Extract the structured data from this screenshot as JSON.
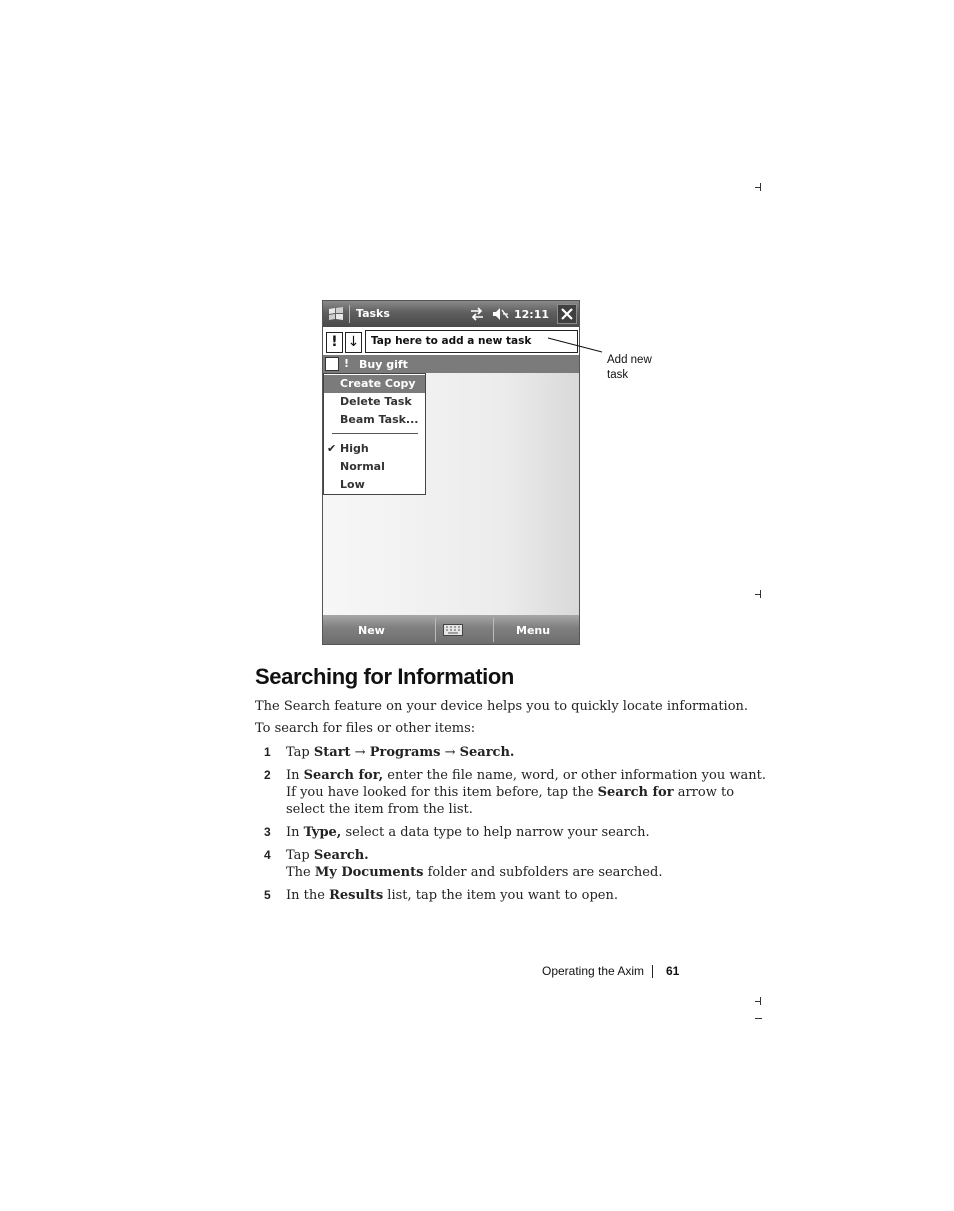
{
  "device": {
    "titlebar": {
      "title": "Tasks",
      "time": "12:11"
    },
    "entry": {
      "priority_label": "!",
      "sort_label": "↓",
      "new_task_prompt": "Tap here to add a new task"
    },
    "task": {
      "priority": "!",
      "label": "Buy gift"
    },
    "context_menu": {
      "items": [
        "Create Copy",
        "Delete Task",
        "Beam Task...",
        "High",
        "Normal",
        "Low"
      ],
      "check": "✔"
    },
    "commandbar": {
      "left": "New",
      "right": "Menu"
    },
    "callout": {
      "line1": "Add new",
      "line2": "task"
    }
  },
  "document": {
    "heading": "Searching for Information",
    "intro": "The Search feature on your device helps you to quickly locate information.",
    "lead": "To search for files or other items:",
    "steps": [
      {
        "num": "1",
        "l1a": "Tap ",
        "l1b": "Start",
        "l1c": " → ",
        "l1d": "Programs",
        "l1e": " → ",
        "l1f": "Search."
      },
      {
        "num": "2",
        "l1a": "In ",
        "l1b": "Search for,",
        "l1c": " enter the file name, word, or other information you want.",
        "l2a": "If you have looked for this item before, tap the ",
        "l2b": "Search for",
        "l2c": " arrow to",
        "l3": "select the item from the list."
      },
      {
        "num": "3",
        "l1a": "In ",
        "l1b": "Type,",
        "l1c": " select a data type to help narrow your search."
      },
      {
        "num": "4",
        "l1a": "Tap ",
        "l1b": "Search.",
        "l2a": "The ",
        "l2b": "My Documents",
        "l2c": " folder and subfolders are searched."
      },
      {
        "num": "5",
        "l1a": "In the ",
        "l1b": "Results",
        "l1c": " list, tap the item you want to open."
      }
    ]
  },
  "footer": {
    "section": "Operating the Axim",
    "page": "61"
  }
}
